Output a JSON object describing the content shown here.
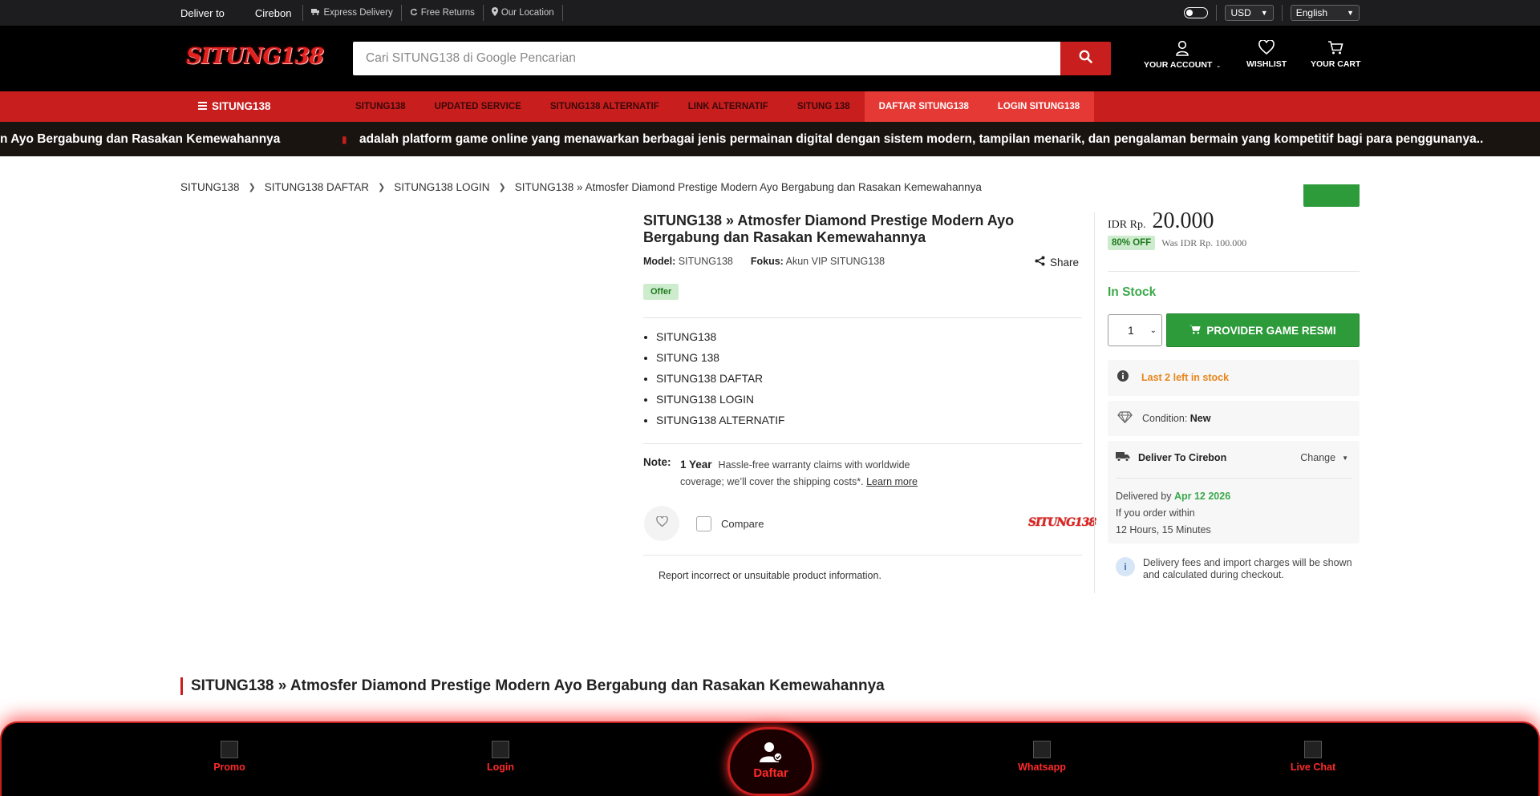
{
  "topbar": {
    "deliver_label": "Deliver to",
    "deliver_city": "Cirebon",
    "links": [
      "Express Delivery",
      "Free Returns",
      "Our Location"
    ],
    "currency": "USD",
    "language": "English"
  },
  "header": {
    "logo": "SITUNG138",
    "search_placeholder": "Cari SITUNG138 di Google Pencarian",
    "account_label": "YOUR ACCOUNT",
    "wishlist_label": "WISHLIST",
    "cart_label": "YOUR CART"
  },
  "nav": {
    "brand": "SITUNG138",
    "links": [
      "SITUNG138",
      "UPDATED SERVICE",
      "SITUNG138 ALTERNATIF",
      "LINK ALTERNATIF",
      "SITUNG 138",
      "DAFTAR SITUNG138",
      "LOGIN SITUNG138"
    ]
  },
  "marquee": {
    "text_a": "n Ayo Bergabung dan Rasakan Kemewahannya",
    "text_b": "adalah platform game online yang menawarkan berbagai jenis permainan digital dengan sistem modern, tampilan menarik, dan pengalaman bermain yang kompetitif bagi para penggunanya.."
  },
  "breadcrumb": [
    "SITUNG138",
    "SITUNG138 DAFTAR",
    "SITUNG138 LOGIN",
    "SITUNG138 » Atmosfer Diamond Prestige Modern Ayo Bergabung dan Rasakan Kemewahannya"
  ],
  "product": {
    "title": "SITUNG138 » Atmosfer Diamond Prestige Modern Ayo Bergabung dan Rasakan Kemewahannya",
    "model_label": "Model:",
    "model_value": "SITUNG138",
    "focus_label": "Fokus:",
    "focus_value": "Akun VIP SITUNG138",
    "share_label": "Share",
    "offer_badge": "Offer",
    "features": [
      "SITUNG138",
      "SITUNG 138",
      "SITUNG138 DAFTAR",
      "SITUNG138 LOGIN",
      "SITUNG138 ALTERNATIF"
    ],
    "note_label": "Note:",
    "note_bold": "1 Year",
    "note_text": "Hassle-free warranty claims with worldwide coverage; we’ll cover the shipping costs*.",
    "learn_more": "Learn more",
    "compare_label": "Compare",
    "brand_logo": "SITUNG138",
    "report_text": "Report incorrect or unsuitable product information."
  },
  "buybox": {
    "currency": "IDR Rp.",
    "price": "20.000",
    "discount": "80% OFF",
    "was": "Was IDR Rp. 100.000",
    "stock": "In Stock",
    "quantity": "1",
    "buy_label": "PROVIDER GAME RESMI",
    "stock_warning": "Last 2 left in stock",
    "condition_label": "Condition:",
    "condition_value": "New",
    "deliver_to": "Deliver To Cirebon",
    "change_label": "Change",
    "delivered_by_label": "Delivered by",
    "delivered_by_date": "Apr 12 2026",
    "order_within_label": "If you order within",
    "order_within_time": "12 Hours, 15 Minutes",
    "fees_note": "Delivery fees and import charges will be shown and calculated during checkout."
  },
  "section_title": "SITUNG138 » Atmosfer Diamond Prestige Modern Ayo Bergabung dan Rasakan Kemewahannya",
  "bottom_nav": {
    "promo": "Promo",
    "login": "Login",
    "daftar": "Daftar",
    "whatsapp": "Whatsapp",
    "livechat": "Live Chat"
  },
  "colors": {
    "brand_red": "#c81e1e",
    "buy_green": "#2e9b3b",
    "warning_orange": "#e8851c"
  }
}
